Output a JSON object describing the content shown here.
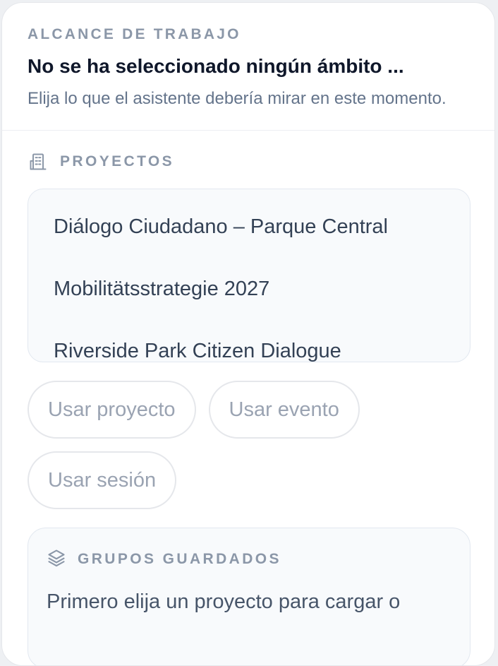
{
  "scope": {
    "eyebrow": "ALCANCE DE TRABAJO",
    "title": "No se ha seleccionado ningún ámbito ...",
    "subtitle": "Elija lo que el asistente debería mirar en este momento."
  },
  "projects": {
    "label": "PROYECTOS",
    "icon": "building-icon",
    "items": [
      {
        "label": "Diálogo Ciudadano – Parque Central"
      },
      {
        "label": "Mobilitätsstrategie 2027"
      },
      {
        "label": "Riverside Park Citizen Dialogue"
      }
    ]
  },
  "actions": {
    "use_project": "Usar proyecto",
    "use_event": "Usar evento",
    "use_session": "Usar sesión"
  },
  "saved_groups": {
    "label": "GRUPOS GUARDADOS",
    "icon": "layers-icon",
    "text": "Primero elija un proyecto para cargar o"
  },
  "colors": {
    "muted": "#8b97a8",
    "title": "#0f172a",
    "chip_text": "#9aa3b2"
  }
}
